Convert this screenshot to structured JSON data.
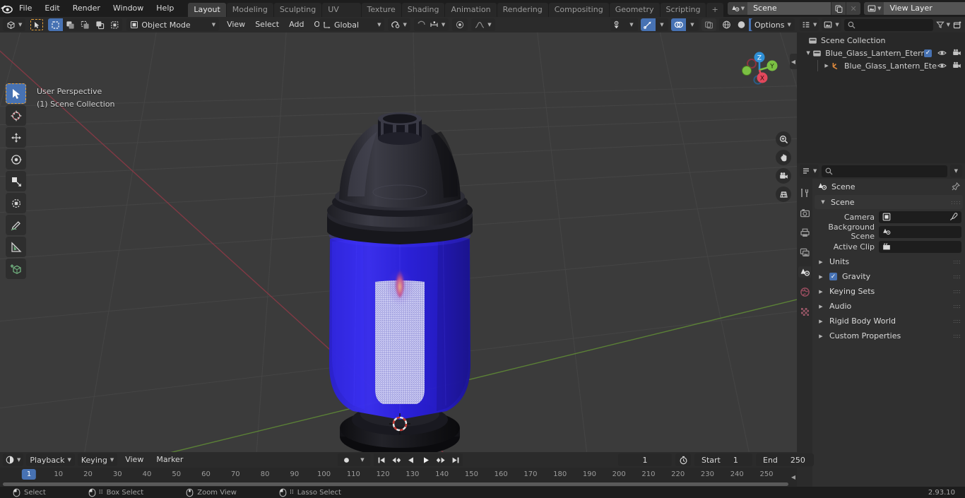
{
  "app": {
    "version": "2.93.10"
  },
  "topbar": {
    "logo_icon": "blender-logo-icon",
    "menus": [
      "File",
      "Edit",
      "Render",
      "Window",
      "Help"
    ],
    "workspaces": [
      {
        "label": "Layout",
        "active": true
      },
      {
        "label": "Modeling",
        "active": false
      },
      {
        "label": "Sculpting",
        "active": false
      },
      {
        "label": "UV Editing",
        "active": false
      },
      {
        "label": "Texture Paint",
        "active": false
      },
      {
        "label": "Shading",
        "active": false
      },
      {
        "label": "Animation",
        "active": false
      },
      {
        "label": "Rendering",
        "active": false
      },
      {
        "label": "Compositing",
        "active": false
      },
      {
        "label": "Geometry Nodes",
        "active": false
      },
      {
        "label": "Scripting",
        "active": false
      }
    ],
    "add_workspace_label": "+",
    "scene": {
      "icon": "scene-icon",
      "name": "Scene",
      "copy_icon": "duplicate-icon",
      "unlink_icon": "x-icon"
    },
    "view_layer": {
      "icon": "view-layer-icon",
      "name": "View Layer",
      "copy_icon": "duplicate-icon",
      "unlink_icon": "x-icon"
    }
  },
  "viewport_header": {
    "editor_type_icon": "editor-type-3dview-icon",
    "mode": "Object Mode",
    "mode_icon": "object-mode-icon",
    "menus": [
      "View",
      "Select",
      "Add",
      "Object"
    ],
    "select_modes": [
      "select-set-icon",
      "select-extend-icon",
      "select-subtract-icon",
      "select-invert-icon",
      "select-intersect-icon"
    ],
    "transform_orientation": {
      "label": "Global",
      "icon": "orientation-global-icon"
    },
    "snap_icon": "magnet-icon",
    "snap_target_icon": "snap-increment-icon",
    "proportional_icon": "proportional-edit-icon",
    "falloff_icon": "falloff-smooth-icon",
    "options_label": "Options",
    "visibility_icon": "eye-dropper-visibility-icon",
    "gizmo_icon": "gizmo-icon",
    "overlays_icon": "overlays-icon",
    "xray_icon": "xray-icon",
    "shading": [
      "wireframe-icon",
      "solid-icon",
      "material-preview-icon",
      "rendered-icon"
    ],
    "shading_active_index": 2
  },
  "viewport": {
    "overlay_line1": "User Perspective",
    "overlay_line2": "(1) Scene Collection",
    "toolbar": [
      {
        "name": "tweak-select-tool",
        "icon": "cursor-arrow-icon",
        "active": true
      },
      {
        "name": "cursor-tool",
        "icon": "3d-cursor-icon",
        "active": false
      },
      {
        "name": "move-tool",
        "icon": "move-arrows-icon",
        "active": false
      },
      {
        "name": "rotate-tool",
        "icon": "rotate-icon",
        "active": false
      },
      {
        "name": "scale-tool",
        "icon": "scale-icon",
        "active": false
      },
      {
        "name": "transform-tool",
        "icon": "transform-icon",
        "active": false
      },
      {
        "name": "annotate-tool",
        "icon": "pencil-icon",
        "active": false
      },
      {
        "name": "measure-tool",
        "icon": "ruler-icon",
        "active": false
      },
      {
        "name": "add-cube-tool",
        "icon": "add-cube-icon",
        "active": false
      }
    ],
    "nav_buttons": [
      "zoom-icon",
      "hand-pan-icon",
      "camera-icon",
      "perspective-ortho-icon"
    ],
    "axis_gizmo": {
      "x": "X",
      "y": "Y",
      "z": "Z",
      "x_color": "#e2485c",
      "y_color": "#7bc043",
      "z_color": "#2e8fd6"
    },
    "object_name": "Blue_Glass_Lantern_Eternal_Candle",
    "object_colors": {
      "glass": "#2b21e0",
      "cap": "#2a2a30",
      "base": "#17171a",
      "candle": "#c9c9f2",
      "flame": "#c94a7a"
    }
  },
  "outliner": {
    "editor_icon": "outliner-icon",
    "display_mode_icon": "view-layer-icon",
    "search_placeholder": "",
    "filter_icon": "filter-icon",
    "new_collection_icon": "new-collection-icon",
    "rows": [
      {
        "indent": 0,
        "tri": "",
        "icon": "collection-icon",
        "label": "Scene Collection",
        "checkbox": false,
        "eye": false,
        "camera": false
      },
      {
        "indent": 1,
        "tri": "down",
        "icon": "collection-icon",
        "label": "Blue_Glass_Lantern_Eternal_C",
        "checkbox": true,
        "eye": true,
        "camera": true
      },
      {
        "indent": 2,
        "tri": "right",
        "icon": "mesh-data-icon",
        "label": "Blue_Glass_Lantern_Eter",
        "checkbox": false,
        "eye": true,
        "camera": true
      }
    ]
  },
  "properties": {
    "editor_icon": "properties-icon",
    "search_placeholder": "",
    "tabs": [
      {
        "name": "tool-tab",
        "icon": "tool-icon",
        "active": false
      },
      {
        "name": "render-tab",
        "icon": "render-camera-icon",
        "active": false
      },
      {
        "name": "output-tab",
        "icon": "printer-output-icon",
        "active": false
      },
      {
        "name": "view-layer-tab",
        "icon": "view-layer-images-icon",
        "active": false
      },
      {
        "name": "scene-tab",
        "icon": "scene-cone-icon",
        "active": true
      },
      {
        "name": "world-tab",
        "icon": "world-globe-icon",
        "active": false
      },
      {
        "name": "texture-tab",
        "icon": "texture-checker-icon",
        "active": false
      }
    ],
    "breadcrumb": {
      "icon": "scene-cone-icon",
      "label": "Scene",
      "pin_icon": "pin-icon"
    },
    "panels": [
      {
        "type": "header",
        "label": "Scene",
        "open": true
      },
      {
        "type": "row",
        "label": "Camera",
        "value": "",
        "icon": "camera-object-icon",
        "eyedropper": true
      },
      {
        "type": "row",
        "label": "Background Scene",
        "value": "",
        "icon": "scene-cone-icon",
        "eyedropper": false
      },
      {
        "type": "row",
        "label": "Active Clip",
        "value": "",
        "icon": "movie-clip-icon",
        "eyedropper": false
      },
      {
        "type": "sub",
        "label": "Units",
        "open": false,
        "checkbox": null
      },
      {
        "type": "sub",
        "label": "Gravity",
        "open": false,
        "checkbox": true
      },
      {
        "type": "sub",
        "label": "Keying Sets",
        "open": false,
        "checkbox": null
      },
      {
        "type": "sub",
        "label": "Audio",
        "open": false,
        "checkbox": null
      },
      {
        "type": "sub",
        "label": "Rigid Body World",
        "open": false,
        "checkbox": null
      },
      {
        "type": "sub",
        "label": "Custom Properties",
        "open": false,
        "checkbox": null
      }
    ]
  },
  "timeline": {
    "editor_icon": "timeline-icon",
    "menus": [
      "Playback",
      "Keying",
      "View",
      "Marker"
    ],
    "record_icon": "record-icon",
    "transport": [
      "jump-start-icon",
      "prev-keyframe-icon",
      "play-reverse-icon",
      "play-icon",
      "next-keyframe-icon",
      "jump-end-icon"
    ],
    "current_frame": "1",
    "auto_key_icon": "stopwatch-icon",
    "start_label": "Start",
    "start_value": "1",
    "end_label": "End",
    "end_value": "250",
    "ticks": [
      "10",
      "20",
      "30",
      "40",
      "50",
      "60",
      "70",
      "80",
      "90",
      "100",
      "110",
      "120",
      "130",
      "140",
      "150",
      "160",
      "170",
      "180",
      "190",
      "200",
      "210",
      "220",
      "230",
      "240",
      "250"
    ],
    "playhead_label": "1"
  },
  "statusbar": {
    "items": [
      {
        "icon": "mouse-left-icon",
        "label": "Select"
      },
      {
        "icon": "mouse-left-drag-icon",
        "label": "Box Select"
      },
      {
        "icon": "mouse-middle-icon",
        "label": "Zoom View"
      },
      {
        "icon": "mouse-left-drag-icon",
        "label": "Lasso Select"
      }
    ],
    "version": "2.93.10"
  }
}
